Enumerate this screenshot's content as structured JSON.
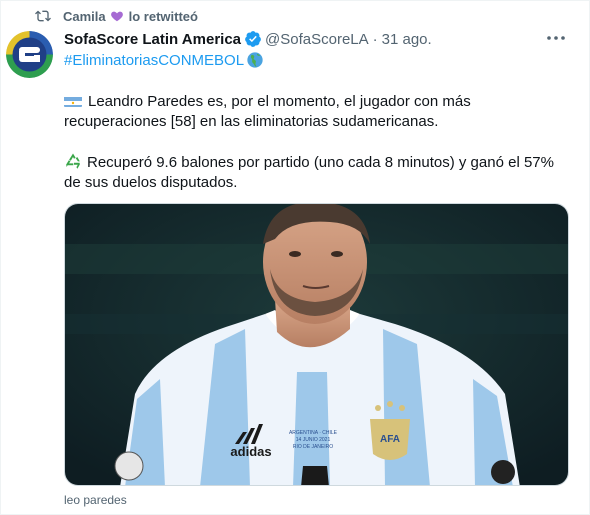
{
  "retweet": {
    "user": "Camila",
    "suffix": "lo retwitteó",
    "heart_icon": "purple-heart-icon"
  },
  "tweet": {
    "display_name": "SofaScore Latin America",
    "handle": "@SofaScoreLA",
    "separator": "·",
    "date": "31 ago.",
    "hashtag": "#EliminatoriasCONMEBOL",
    "paragraphs": [
      "Leandro Paredes es, por el momento, el jugador con más recuperaciones [58] en las eliminatorias sudamericanas.",
      "Recuperó 9.6 balones por partido (uno cada 8 minutos) y ganó el 57% de sus duelos disputados."
    ],
    "media_caption": "leo paredes",
    "shirt_text": {
      "match": "ARGENTINA · CHILE",
      "date": "14 JUNIO 2021",
      "city": "RIO DE JANEIRO",
      "brand": "adidas",
      "crest": "AFA"
    }
  },
  "colors": {
    "accent": "#1d9bf0",
    "muted": "#536471",
    "avatar_green": "#2e9e4f",
    "avatar_blue": "#2a5db0"
  }
}
